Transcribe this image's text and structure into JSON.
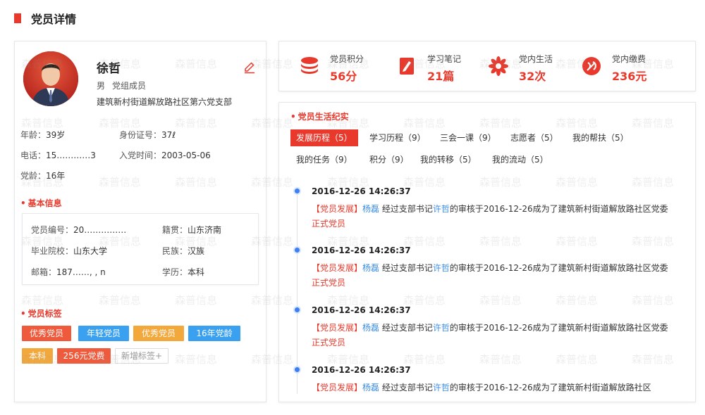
{
  "page": {
    "title": "党员详情"
  },
  "profile": {
    "name": "徐哲",
    "gender": "男",
    "role": "党组成员",
    "branch": "建筑新村街道解放路社区第六党支部",
    "edit_icon": "pencil-icon",
    "age": {
      "label": "年龄：",
      "value": "39岁"
    },
    "id_number": {
      "label": "身份证号：",
      "value": "37ℓ"
    },
    "phone": {
      "label": "电话：",
      "value": "15…………3"
    },
    "join_date": {
      "label": "入党时间：",
      "value": "2003-05-06"
    },
    "party_age": {
      "label": "党龄：",
      "value": "16年"
    }
  },
  "basic_info": {
    "title": "基本信息",
    "member_no": {
      "label": "党员编号：",
      "value": "20……………"
    },
    "native_place": {
      "label": "籍贯：",
      "value": "山东济南"
    },
    "school": {
      "label": "毕业院校：",
      "value": "山东大学"
    },
    "ethnicity": {
      "label": "民族：",
      "value": "汉族"
    },
    "email": {
      "label": "邮箱：",
      "value": "187……, ,   n"
    },
    "education": {
      "label": "学历：",
      "value": "本科"
    }
  },
  "tags": {
    "title": "党员标签",
    "items": [
      {
        "label": "优秀党员",
        "color": "#ef5a3c"
      },
      {
        "label": "年轻党员",
        "color": "#3aa0f0"
      },
      {
        "label": "优秀党员",
        "color": "#f3a83c"
      },
      {
        "label": "16年党龄",
        "color": "#3aa0f0"
      },
      {
        "label": "本科",
        "color": "#f3a83c"
      },
      {
        "label": "256元党费",
        "color": "#ef5a3c"
      }
    ],
    "add_label": "新增标签+"
  },
  "stats": [
    {
      "label": "党员积分",
      "value": "56分",
      "icon": "coin-stack-icon"
    },
    {
      "label": "学习笔记",
      "value": "21篇",
      "icon": "notebook-icon"
    },
    {
      "label": "党内生活",
      "value": "32次",
      "icon": "flower-icon"
    },
    {
      "label": "党内缴费",
      "value": "236元",
      "icon": "party-emblem-icon"
    }
  ],
  "record": {
    "title": "党员生活纪实",
    "tabs": [
      {
        "label": "发展历程（5）",
        "active": true
      },
      {
        "label": "学习历程（9）"
      },
      {
        "label": "三会一课（9）"
      },
      {
        "label": "志愿者（5）"
      },
      {
        "label": "我的帮扶（5）"
      },
      {
        "label": "我的任务（9）"
      },
      {
        "label": "积分（9）"
      },
      {
        "label": "我的转移（5）"
      },
      {
        "label": "我的流动（5）"
      }
    ],
    "events": [
      {
        "time": "2016-12-26  14:26:37",
        "category": "【党员发展】",
        "person": "杨磊",
        "text1": " 经过支部书记",
        "secretary": "许哲",
        "text2": "的审核于2016-12-26成为了建筑新村街道解放路社区党委 ",
        "status": "正式党员"
      },
      {
        "time": "2016-12-26  14:26:37",
        "category": "【党员发展】",
        "person": "杨磊",
        "text1": " 经过支部书记",
        "secretary": "许哲",
        "text2": "的审核于2016-12-26成为了建筑新村街道解放路社区党委 ",
        "status": "正式党员"
      },
      {
        "time": "2016-12-26  14:26:37",
        "category": "【党员发展】",
        "person": "杨磊",
        "text1": " 经过支部书记",
        "secretary": "许哲",
        "text2": "的审核于2016-12-26成为了建筑新村街道解放路社区党委 ",
        "status": "正式党员"
      },
      {
        "time": "2016-12-26  14:26:37",
        "category": "【党员发展】",
        "person": "杨磊",
        "text1": " 经过支部书记",
        "secretary": "许哲",
        "text2": "的审核于2016-12-26成为了建筑新村街道解放路社区",
        "status": ""
      }
    ]
  },
  "watermark": "森普信息",
  "colors": {
    "accent": "#e8392c",
    "link": "#3a8ee6",
    "timeline_dot": "#3d7ef0"
  }
}
